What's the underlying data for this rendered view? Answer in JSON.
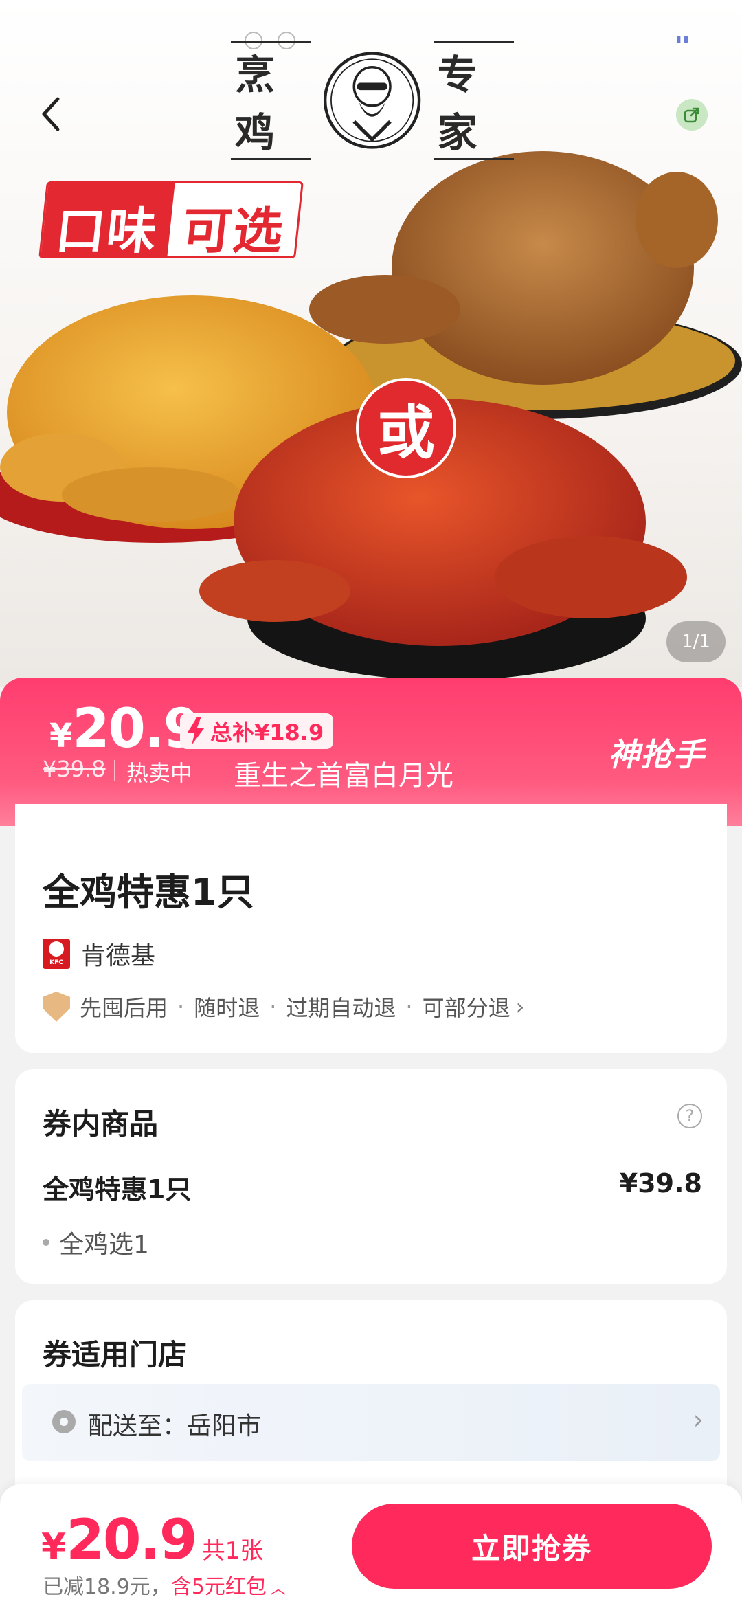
{
  "hero": {
    "brand_left": "烹鸡",
    "brand_right": "专家",
    "tag_part1": "口味",
    "tag_part2": "可选",
    "or_label": "或",
    "image_counter": "1/1"
  },
  "banner": {
    "currency": "¥",
    "price": "20.9",
    "subsidy": "总补¥18.9",
    "original_price": "¥39.8",
    "status": "热卖中",
    "overlay_text": "重生之首富白月光",
    "badge": "神抢手"
  },
  "product": {
    "title": "全鸡特惠1只",
    "shop_name": "肯德基",
    "kfc_logo_text": "KFC",
    "guarantees": [
      "先囤后用",
      "随时退",
      "过期自动退",
      "可部分退"
    ]
  },
  "contents": {
    "section_title": "券内商品",
    "item_name": "全鸡特惠1只",
    "item_price": "¥39.8",
    "sub_item": "全鸡选1"
  },
  "stores": {
    "section_title": "券适用门店",
    "deliver_to": "配送至：岳阳市"
  },
  "bottom": {
    "currency": "¥",
    "price": "20.9",
    "count": "共1张",
    "saved": "已减18.9元，",
    "red_packet": "含5元红包",
    "button_label": "立即抢券"
  },
  "colors": {
    "accent": "#ff2a5b",
    "banner_top": "#ff3d6e",
    "tag_red": "#e32831"
  }
}
